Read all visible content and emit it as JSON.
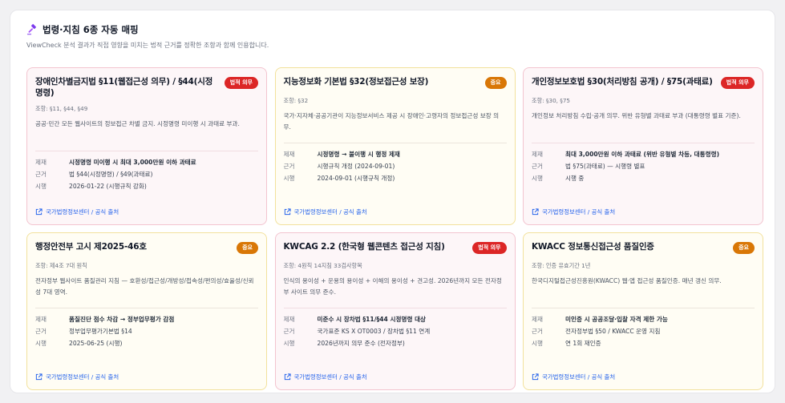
{
  "panel": {
    "title": "법령·지침 6종 자동 매핑",
    "subtitle": "ViewCheck 분석 결과가 직접 영향을 미치는 법적 근거를 정확한 조항과 함께 인용합니다.",
    "icon": "hammer-icon",
    "accent_color": "#7c3aed"
  },
  "row_labels": {
    "penalty": "제재",
    "basis": "근거",
    "effective": "시행"
  },
  "cards": [
    {
      "title": "장애인차별금지법 §11(웹접근성 의무) / §44(시정명령)",
      "badge": "법적 의무",
      "tone": "red",
      "article": "조항: §11, §44, §49",
      "desc": "공공·민간 모든 웹사이트의 정보접근 차별 금지. 시정명령 미이행 시 과태료 부과.",
      "penalty": "시정명령 미이행 시 최대 3,000만원 이하 과태료",
      "basis": "법 §44(시정명령) / §49(과태료)",
      "effective": "2026-01-22 (시행규칙 강화)",
      "source": "국가법령정보센터 / 공식 출처"
    },
    {
      "title": "지능정보화 기본법 §32(정보접근성 보장)",
      "badge": "중요",
      "tone": "amber",
      "article": "조항: §32",
      "desc": "국가·지자체·공공기관이 지능정보서비스 제공 시 장애인·고령자의 정보접근성 보장 의무.",
      "penalty": "시정명령 → 불이행 시 행정 제재",
      "basis": "시행규칙 개정 (2024-09-01)",
      "effective": "2024-09-01 (시행규칙 개정)",
      "source": "국가법령정보센터 / 공식 출처"
    },
    {
      "title": "개인정보보호법 §30(처리방침 공개) / §75(과태료)",
      "badge": "법적 의무",
      "tone": "red",
      "article": "조항: §30, §75",
      "desc": "개인정보 처리방침 수립·공개 의무. 위반 유형별 과태료 부과 (대통령령 별표 기준).",
      "penalty": "최대 3,000만원 이하 과태료 (위반 유형별 차등, 대통령령)",
      "basis": "법 §75(과태료) — 시행령 별표",
      "effective": "시행 중",
      "source": "국가법령정보센터 / 공식 출처"
    },
    {
      "title": "행정안전부 고시 제2025-46호",
      "badge": "중요",
      "tone": "amber",
      "article": "조항: 제4조 7대 원칙",
      "desc": "전자정부 웹사이트 품질관리 지침 — 호환성/접근성/개방성/접속성/편의성/효율성/신뢰성 7대 영역.",
      "penalty": "품질진단 점수 차감 → 정부업무평가 감점",
      "basis": "정부업무평가기본법 §14",
      "effective": "2025-06-25 (시행)",
      "source": "국가법령정보센터 / 공식 출처"
    },
    {
      "title": "KWCAG 2.2 (한국형 웹콘텐츠 접근성 지침)",
      "badge": "법적 의무",
      "tone": "red",
      "article": "조항: 4원칙 14지침 33검사항목",
      "desc": "인식의 용이성 + 운용의 용이성 + 이해의 용이성 + 견고성. 2026년까지 모든 전자정부 사이트 의무 준수.",
      "penalty": "미준수 시 장차법 §11/§44 시정명령 대상",
      "basis": "국가표준 KS X OT0003 / 장차법 §11 연계",
      "effective": "2026년까지 의무 준수 (전자정부)",
      "source": "국가법령정보센터 / 공식 출처"
    },
    {
      "title": "KWACC 정보통신접근성 품질인증",
      "badge": "중요",
      "tone": "amber",
      "article": "조항: 인증 유효기간 1년",
      "desc": "한국디지털접근성진흥원(KWACC) 웹·앱 접근성 품질인증. 매년 갱신 의무.",
      "penalty": "미인증 시 공공조달·입찰 자격 제한 가능",
      "basis": "전자정부법 §50 / KWACC 운영 지침",
      "effective": "연 1회 재인증",
      "source": "국가법령정보센터 / 공식 출처"
    }
  ]
}
